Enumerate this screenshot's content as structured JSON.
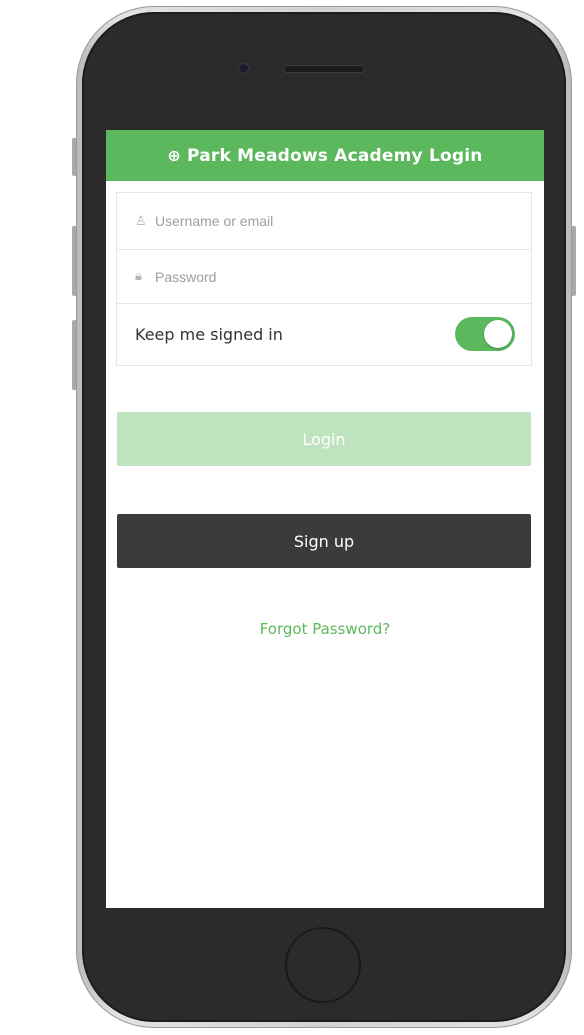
{
  "header": {
    "icon": "sign-in-icon",
    "icon_glyph": "⊕",
    "title": "Park Meadows Academy Login"
  },
  "form": {
    "username": {
      "icon": "user-icon",
      "icon_glyph": "♙",
      "placeholder": "Username or email",
      "value": ""
    },
    "password": {
      "icon": "lock-icon",
      "icon_glyph": "🔒︎",
      "placeholder": "Password",
      "value": ""
    },
    "keep_signed_in": {
      "label": "Keep me signed in",
      "enabled": true
    }
  },
  "buttons": {
    "login_label": "Login",
    "signup_label": "Sign up"
  },
  "links": {
    "forgot_password": "Forgot Password?"
  },
  "colors": {
    "accent": "#5cb85c",
    "login_disabled": "#bfe3bf",
    "signup_bg": "#3b3b3b",
    "phone_body": "#2b2b2b"
  }
}
